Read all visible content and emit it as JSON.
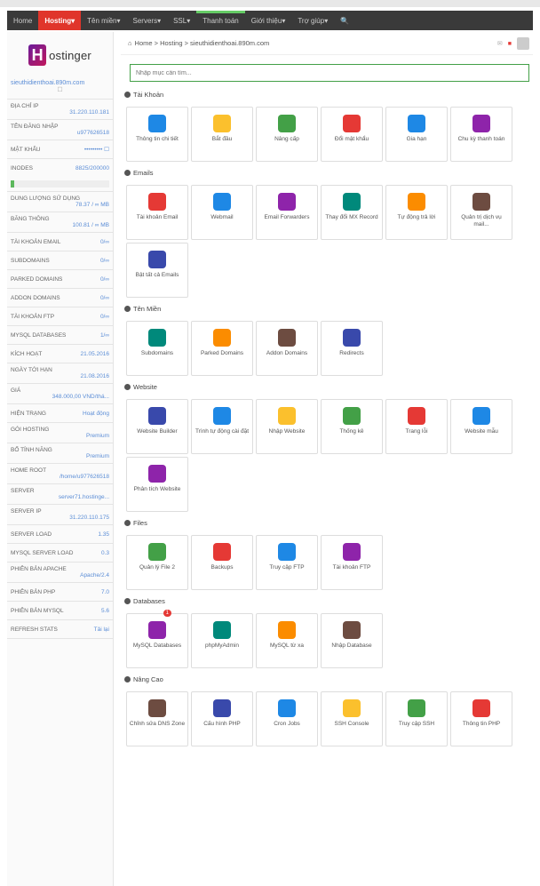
{
  "nav": {
    "items": [
      "Home",
      "Hosting",
      "Tên miền",
      "Servers",
      "SSL",
      "Thanh toán",
      "Giới thiệu",
      "Trợ giúp",
      "🔍"
    ]
  },
  "sidebar": {
    "logo_text": "ostinger",
    "domain": "sieuthidienthoai.890m.com",
    "rows": [
      {
        "label": "ĐỊA CHỈ IP",
        "value": "31.220.110.181"
      },
      {
        "label": "TÊN ĐĂNG NHẬP",
        "value": "u977626518"
      },
      {
        "label": "MẬT KHẨU",
        "value": "••••••••• ☐"
      },
      {
        "label": "INODES",
        "value": "8825/200000"
      },
      {
        "label": "DUNG LƯỢNG SỬ DỤNG",
        "value": "78.37 / ∞ MB"
      },
      {
        "label": "BĂNG THÔNG",
        "value": "100.81 / ∞ MB"
      },
      {
        "label": "TÀI KHOẢN EMAIL",
        "value": "0/∞"
      },
      {
        "label": "SUBDOMAINS",
        "value": "0/∞"
      },
      {
        "label": "PARKED DOMAINS",
        "value": "0/∞"
      },
      {
        "label": "ADDON DOMAINS",
        "value": "0/∞"
      },
      {
        "label": "TÀI KHOẢN FTP",
        "value": "0/∞"
      },
      {
        "label": "MYSQL DATABASES",
        "value": "1/∞"
      },
      {
        "label": "KÍCH HOẠT",
        "value": "21.05.2016"
      },
      {
        "label": "NGÀY TỚI HẠN",
        "value": "21.08.2016"
      },
      {
        "label": "GIÁ",
        "value": "348.000,00 VND/thá..."
      },
      {
        "label": "HIỆN TRẠNG",
        "value": "Hoạt động"
      },
      {
        "label": "GÓI HOSTING",
        "value": "Premium"
      },
      {
        "label": "BỔ TÍNH NĂNG",
        "value": "Premium"
      },
      {
        "label": "HOME ROOT",
        "value": "/home/u977626518"
      },
      {
        "label": "SERVER",
        "value": "server71.hostinge..."
      },
      {
        "label": "SERVER IP",
        "value": "31.220.110.175"
      },
      {
        "label": "SERVER LOAD",
        "value": "1.35"
      },
      {
        "label": "MYSQL SERVER LOAD",
        "value": "0.3"
      },
      {
        "label": "PHIÊN BẢN APACHE",
        "value": "Apache/2.4"
      },
      {
        "label": "PHIÊN BẢN PHP",
        "value": "7.0"
      },
      {
        "label": "PHIÊN BẢN MYSQL",
        "value": "5.6"
      },
      {
        "label": "REFRESH STATS",
        "value": "Tải lại"
      }
    ],
    "inodes_usage": 0.04
  },
  "breadcrumb": "Home > Hosting > sieuthidienthoai.890m.com",
  "search_placeholder": "Nhập mục cần tìm...",
  "sections": [
    {
      "title": "Tài Khoản",
      "tiles": [
        "Thông tin chi tiết",
        "Bắt đầu",
        "Nâng cấp",
        "Đổi mật khẩu",
        "Gia hạn",
        "Chu kỳ thanh toán"
      ]
    },
    {
      "title": "Emails",
      "tiles": [
        "Tài khoản Email",
        "Webmail",
        "Email Forwarders",
        "Thay đổi MX Record",
        "Tự động trả lời",
        "Quản trị dịch vụ mail...",
        "Bật tất cả Emails"
      ]
    },
    {
      "title": "Tên Miền",
      "tiles": [
        "Subdomains",
        "Parked Domains",
        "Addon Domains",
        "Redirects"
      ]
    },
    {
      "title": "Website",
      "tiles": [
        "Website Builder",
        "Trình tự động cài đặt",
        "Nhập Website",
        "Thống kê",
        "Trang lỗi",
        "Website mẫu",
        "Phân tích Website"
      ]
    },
    {
      "title": "Files",
      "tiles": [
        "Quản lý File 2",
        "Backups",
        "Truy cập FTP",
        "Tài khoản FTP"
      ]
    },
    {
      "title": "Databases",
      "tiles": [
        "MySQL Databases",
        "phpMyAdmin",
        "MySQL từ xa",
        "Nhập Database"
      ]
    },
    {
      "title": "Nâng Cao",
      "tiles": [
        "Chỉnh sửa DNS Zone",
        "Cấu hình PHP",
        "Cron Jobs",
        "SSH Console",
        "Truy cập SSH",
        "Thông tin PHP"
      ]
    }
  ],
  "badge_count": "1",
  "colors": {
    "accent": "#e0352b",
    "nav_bg": "#3a3a3a",
    "link": "#5b8dd6"
  }
}
